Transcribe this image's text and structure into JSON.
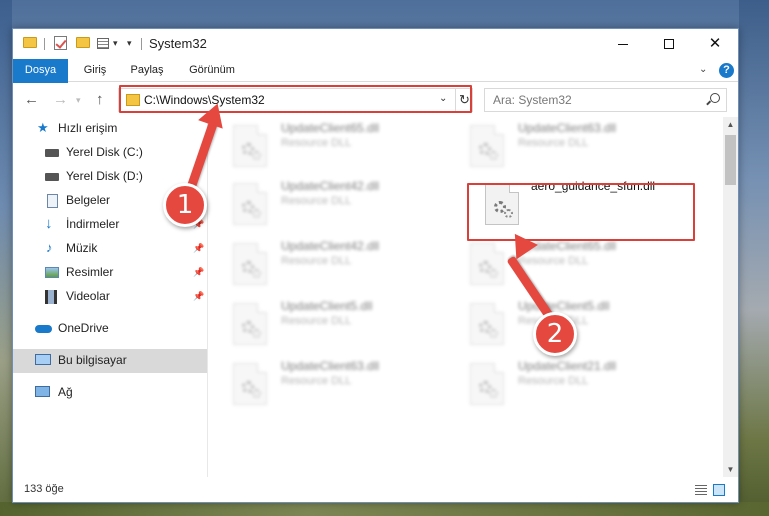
{
  "window": {
    "title": "System32",
    "controls": {
      "minimize": "",
      "maximize": "",
      "close": "✕"
    }
  },
  "ribbon": {
    "tabs": [
      "Dosya",
      "Giriş",
      "Paylaş",
      "Görünüm"
    ]
  },
  "navigation": {
    "back": "←",
    "forward": "→",
    "up": "↑",
    "address": "C:\\Windows\\System32",
    "refresh": "↻",
    "search_placeholder": "Ara: System32"
  },
  "sidebar": {
    "items": [
      {
        "label": "Hızlı erişim",
        "icon": "star-icon",
        "pinned": false
      },
      {
        "label": "Yerel Disk (C:)",
        "icon": "drive-icon",
        "pinned": false
      },
      {
        "label": "Yerel Disk (D:)",
        "icon": "drive-icon",
        "pinned": false
      },
      {
        "label": "Belgeler",
        "icon": "documents-icon",
        "pinned": false
      },
      {
        "label": "İndirmeler",
        "icon": "download-icon",
        "pinned": true
      },
      {
        "label": "Müzik",
        "icon": "music-icon",
        "pinned": true
      },
      {
        "label": "Resimler",
        "icon": "pictures-icon",
        "pinned": true
      },
      {
        "label": "Videolar",
        "icon": "videos-icon",
        "pinned": true
      },
      {
        "label": "OneDrive",
        "icon": "cloud-icon",
        "pinned": false
      },
      {
        "label": "Bu bilgisayar",
        "icon": "computer-icon",
        "pinned": false,
        "selected": true
      },
      {
        "label": "Ağ",
        "icon": "network-icon",
        "pinned": false
      }
    ]
  },
  "files": [
    {
      "name": "UpdateClient65.dll",
      "type": "Resource DLL",
      "blurred": true
    },
    {
      "name": "UpdateClient63.dll",
      "type": "Resource DLL",
      "blurred": true
    },
    {
      "name": "UpdateClient42.dll",
      "type": "Resource DLL",
      "blurred": true
    },
    {
      "name": "aero_guidance_sfun.dll",
      "type": "",
      "blurred": false
    },
    {
      "name": "UpdateClient42.dll",
      "type": "Resource DLL",
      "blurred": true
    },
    {
      "name": "UpdateClient65.dll",
      "type": "Resource DLL",
      "blurred": true
    },
    {
      "name": "UpdateClient5.dll",
      "type": "Resource DLL",
      "blurred": true
    },
    {
      "name": "UpdateClient5.dll",
      "type": "Resource DLL",
      "blurred": true
    },
    {
      "name": "UpdateClient63.dll",
      "type": "Resource DLL",
      "blurred": true
    },
    {
      "name": "UpdateClient21.dll",
      "type": "Resource DLL",
      "blurred": true
    }
  ],
  "status": {
    "item_count": "133 öğe"
  },
  "annotations": {
    "step1": "1",
    "step2": "2",
    "color": "#e4483f"
  },
  "colors": {
    "accent": "#1979ca",
    "highlight": "#d9403a"
  }
}
